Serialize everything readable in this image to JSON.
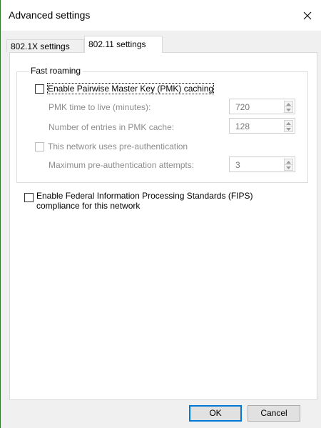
{
  "window": {
    "title": "Advanced settings",
    "close_glyph": "close-icon"
  },
  "tabs": [
    {
      "label": "802.1X settings",
      "selected": false
    },
    {
      "label": "802.11 settings",
      "selected": true
    }
  ],
  "fast_roaming": {
    "legend": "Fast roaming",
    "pmk_caching": {
      "label": "Enable Pairwise Master Key (PMK) caching",
      "checked": false
    },
    "pmk_ttl": {
      "label": "PMK time to live (minutes):",
      "value": "720"
    },
    "pmk_entries": {
      "label": "Number of entries in PMK cache:",
      "value": "128"
    },
    "pre_auth": {
      "label": "This network uses pre-authentication",
      "checked": false
    },
    "max_pre_auth": {
      "label": "Maximum pre-authentication attempts:",
      "value": "3"
    }
  },
  "fips": {
    "line1": "Enable Federal Information Processing Standards (FIPS)",
    "line2": "compliance for this network",
    "checked": false
  },
  "buttons": {
    "ok": "OK",
    "cancel": "Cancel"
  },
  "colors": {
    "focus_border": "#0078d7",
    "disabled_text": "#8d8d8d"
  }
}
